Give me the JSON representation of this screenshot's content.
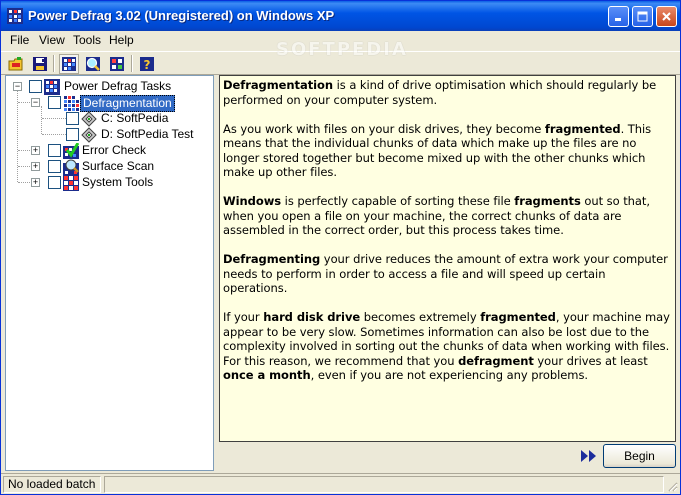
{
  "window": {
    "title": "Power Defrag 3.02 (Unregistered) on Windows XP",
    "watermark": "SOFTPEDIA"
  },
  "menu": {
    "items": [
      {
        "label": "File"
      },
      {
        "label": "View"
      },
      {
        "label": "Tools"
      },
      {
        "label": "Help"
      }
    ]
  },
  "toolbar": {
    "buttons": [
      "open-batch-icon",
      "save-batch-icon",
      "tasks-view-icon",
      "scan-view-icon",
      "tools-view-icon",
      "help-icon"
    ]
  },
  "tree": {
    "root": {
      "label": "Power Defrag Tasks"
    },
    "defrag": {
      "label": "Defragmentation"
    },
    "drive_c": {
      "label": "C: SoftPedia"
    },
    "drive_d": {
      "label": "D: SoftPedia Test"
    },
    "error_check": {
      "label": "Error Check"
    },
    "surface_scan": {
      "label": "Surface Scan"
    },
    "system_tools": {
      "label": "System Tools"
    }
  },
  "info": {
    "p1": {
      "b1": "Defragmentation",
      "t1": " is a kind of drive optimisation which should regularly be performed on your computer system."
    },
    "p2": {
      "t1": "As you work with files on your disk drives, they become ",
      "b1": "fragmented",
      "t2": ". This means that the individual chunks of data which make up the files are no longer stored together but become mixed up with the other chunks which make up other files."
    },
    "p3": {
      "b1": "Windows",
      "t1": " is perfectly capable of sorting these file ",
      "b2": "fragments",
      "t2": " out so that, when you open a file on your machine, the correct chunks of data are assembled in the correct order, but this process takes time."
    },
    "p4": {
      "b1": "Defragmenting",
      "t1": " your drive reduces the amount of extra work your computer needs to perform in order to access a file and will speed up certain operations."
    },
    "p5": {
      "t1": "If your ",
      "b1": "hard disk drive",
      "t2": " becomes extremely ",
      "b2": "fragmented",
      "t3": ", your machine may appear to be very slow. Sometimes information can also be lost due to the complexity involved in sorting out the chunks of data when working with files. For this reason, we recommend that you ",
      "b3": "defragment",
      "t4": " your drives at least ",
      "b4": "once a month",
      "t5": ", even if you are not experiencing any problems."
    }
  },
  "actions": {
    "begin_label": "Begin"
  },
  "status": {
    "batch": "No loaded batch",
    "second": ""
  },
  "colors": {
    "title_bar": "#0055e5",
    "info_background": "#ffffe1",
    "selection": "#316ac5"
  }
}
